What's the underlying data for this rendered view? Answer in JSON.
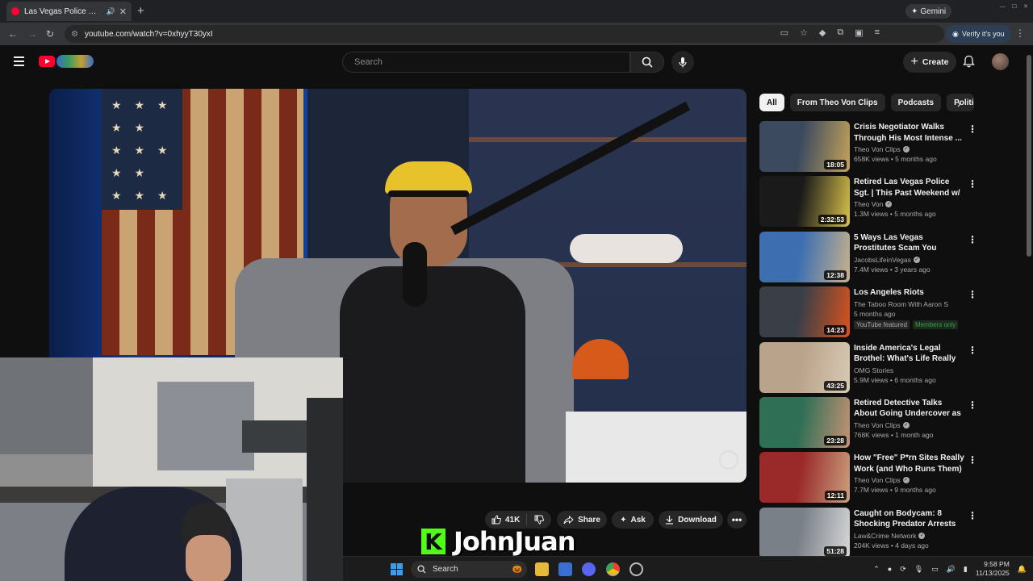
{
  "browser": {
    "tab_title": "Las Vegas Police Officer De",
    "url": "youtube.com/watch?v=0xhyyT30yxI",
    "gemini_label": "Gemini",
    "verify_label": "Verify it's you"
  },
  "youtube": {
    "search_placeholder": "Search",
    "create_label": "Create"
  },
  "actions": {
    "likes": "41K",
    "share": "Share",
    "ask": "Ask",
    "download": "Download"
  },
  "overlay": {
    "streamer_name": "JohnJuan",
    "kick_letter": "K"
  },
  "chips": [
    "All",
    "From Theo Von Clips",
    "Podcasts",
    "Politics"
  ],
  "recommendations": [
    {
      "title": "Crisis Negotiator Walks Through His Most Intense ...",
      "channel": "Theo Von Clips",
      "verified": true,
      "stats": "658K views • 5 months ago",
      "duration": "18:05",
      "colors": [
        "#3b4a5e",
        "#c4a25a"
      ]
    },
    {
      "title": "Retired Las Vegas Police Sgt. | This Past Weekend w/ Theo V...",
      "channel": "Theo Von",
      "verified": true,
      "stats": "1.3M views • 5 months ago",
      "duration": "2:32:53",
      "colors": [
        "#1a1a1a",
        "#d9c14a"
      ]
    },
    {
      "title": "5 Ways Las Vegas Prostitutes Scam You",
      "channel": "JacobsLifeinVegas",
      "verified": true,
      "stats": "7.4M views • 3 years ago",
      "duration": "12:38",
      "colors": [
        "#3d6fb0",
        "#c7b28e"
      ]
    },
    {
      "title": "Los Angeles Riots",
      "channel": "The Taboo Room With Aaron S",
      "verified": false,
      "stats": "5 months ago",
      "duration": "14:23",
      "colors": [
        "#3a3f47",
        "#d9531e"
      ],
      "badges": [
        "YouTube featured",
        "Members only"
      ]
    },
    {
      "title": "Inside America's Legal Brothel: What's Life Really Like?",
      "channel": "OMG Stories",
      "verified": false,
      "stats": "5.9M views • 6 months ago",
      "duration": "43:25",
      "colors": [
        "#b9a38a",
        "#d8c9b5"
      ]
    },
    {
      "title": "Retired Detective Talks About Going Undercover as a ...",
      "channel": "Theo Von Clips",
      "verified": true,
      "stats": "768K views • 1 month ago",
      "duration": "23:28",
      "colors": [
        "#2e6f55",
        "#c59275"
      ]
    },
    {
      "title": "How \"Free\" P*rn Sites Really Work (and Who Runs Them)",
      "channel": "Theo Von Clips",
      "verified": true,
      "stats": "7.7M views • 9 months ago",
      "duration": "12:11",
      "colors": [
        "#9a2a2a",
        "#caa07e"
      ]
    },
    {
      "title": "Caught on Bodycam: 8 Shocking Predator Arrests",
      "channel": "Law&Crime Network",
      "verified": true,
      "stats": "204K views • 4 days ago",
      "duration": "51:28",
      "colors": [
        "#7a8088",
        "#d7d7d7"
      ]
    }
  ],
  "taskbar": {
    "search_label": "Search",
    "time": "9:58 PM",
    "date": "11/13/2025"
  },
  "colors": {
    "youtube_red": "#ff0033",
    "kick_green": "#53fc18",
    "members_green": "#2ba640"
  }
}
